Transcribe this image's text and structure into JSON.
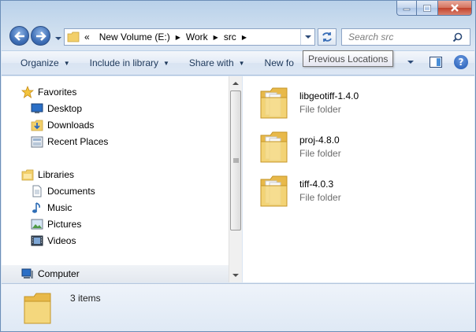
{
  "window": {
    "caption_buttons": [
      "minimize",
      "maximize",
      "close"
    ]
  },
  "address": {
    "crumbs": [
      "New Volume (E:)",
      "Work",
      "src"
    ],
    "overflow_marker": "«"
  },
  "search": {
    "placeholder": "Search src"
  },
  "tooltip": {
    "text": "Previous Locations"
  },
  "commands": {
    "organize": "Organize",
    "include": "Include in library",
    "share": "Share with",
    "new_folder": "New fo"
  },
  "nav": {
    "favorites": "Favorites",
    "desktop": "Desktop",
    "downloads": "Downloads",
    "recent": "Recent Places",
    "libraries": "Libraries",
    "documents": "Documents",
    "music": "Music",
    "pictures": "Pictures",
    "videos": "Videos",
    "computer": "Computer"
  },
  "files": [
    {
      "name": "libgeotiff-1.4.0",
      "type": "File folder"
    },
    {
      "name": "proj-4.8.0",
      "type": "File folder"
    },
    {
      "name": "tiff-4.0.3",
      "type": "File folder"
    }
  ],
  "details": {
    "count": "3 items"
  },
  "colors": {
    "accent": "#1e395b",
    "folder": "#f2cf6a",
    "close": "#c2422b"
  }
}
